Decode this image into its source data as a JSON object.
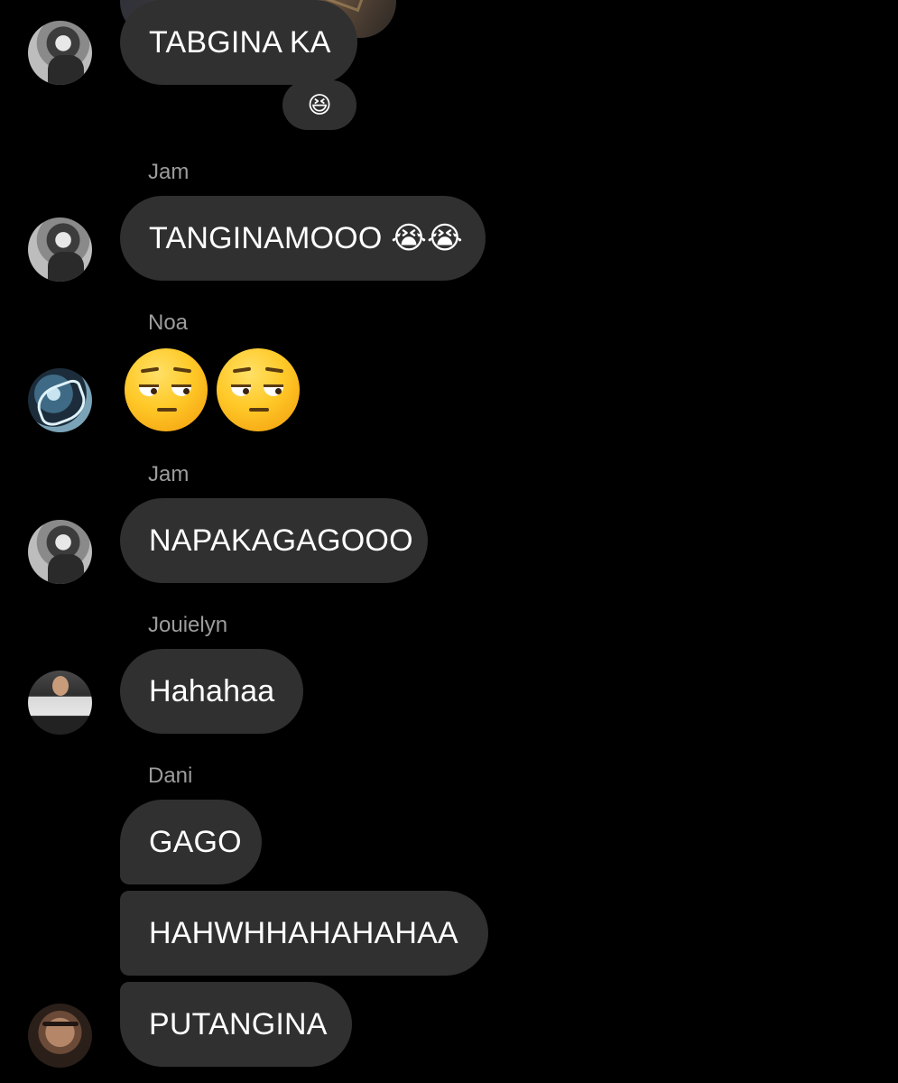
{
  "messages": [
    {
      "sender": "",
      "text": "TABGINA KA",
      "reaction": "😆"
    },
    {
      "sender": "Jam",
      "text": "TANGINAMOOO 😭😭"
    },
    {
      "sender": "Noa",
      "text": "😒😒"
    },
    {
      "sender": "Jam",
      "text": "NAPAKAGAGOOO"
    },
    {
      "sender": "Jouielyn",
      "text": "Hahahaa"
    },
    {
      "sender": "Dani",
      "text": "GAGO"
    },
    {
      "sender": "",
      "text": "HAHWHHAHAHAHAA"
    },
    {
      "sender": "",
      "text": "PUTANGINA"
    }
  ],
  "colors": {
    "background": "#000000",
    "bubble": "#303030",
    "sender_name": "#9c9c9c",
    "text": "#ffffff"
  }
}
